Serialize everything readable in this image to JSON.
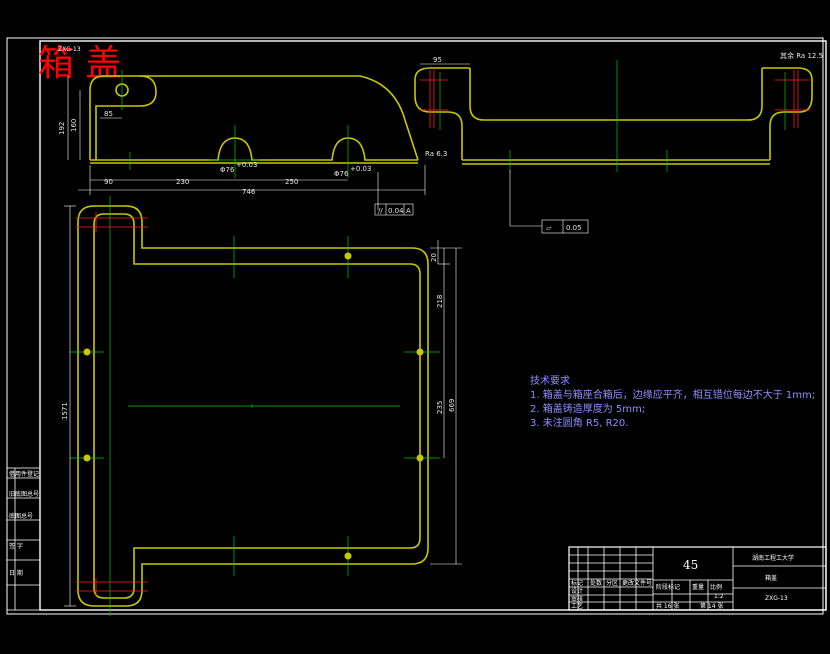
{
  "title_overlay": "箱 盖",
  "drawing_no_small": "ZXG-13",
  "colors": {
    "background": "#000000",
    "border": "#ffffff",
    "outline": "#c8c800",
    "center_line": "#00c800",
    "section_red": "#ff2020",
    "note_text": "#8f8fff",
    "title_red": "#ff0000"
  },
  "front_view": {
    "dims": {
      "h192": "192",
      "h160": "160",
      "r85": "85",
      "x90": "90",
      "x230": "230",
      "x250": "250",
      "total": "746",
      "bore1": "Φ76",
      "bore2": "Φ76",
      "bore1_tol": "+0.03",
      "bore2_tol": "+0.03",
      "ra_right": "Ra 6.3",
      "tol_frame_sym": "//",
      "tol_frame_val": "0.04",
      "tol_frame_ref": "A"
    }
  },
  "side_view": {
    "dims": {
      "w95": "95"
    },
    "flatness_sym": "▱",
    "flatness_val": "0.05",
    "corner_mark": "其余 Ra 12.5"
  },
  "top_view": {
    "dims": {
      "h1571": "1571",
      "h669": "669",
      "d218": "218",
      "d235": "235",
      "d20": "20"
    }
  },
  "notes": {
    "heading": "技术要求",
    "line1": "1. 箱盖与箱座合箱后，边缘应平齐，相互错位每边不大于 1mm;",
    "line2": "2. 箱盖铸造厚度为 5mm;",
    "line3": "3. 未注圆角 R5, R20."
  },
  "title_block": {
    "material": "45",
    "school": "湖南工程工大学",
    "part_name": "箱盖",
    "drawing_no": "ZXG-13",
    "scale": "1:2",
    "sheet_label": "共 16 张",
    "sheet_of": "第 14 张",
    "cells": [
      "标记",
      "处数",
      "分区",
      "更改文件号",
      "签名",
      "年月日",
      "设计",
      "标准化",
      "审核",
      "工艺",
      "批准",
      "阶段标记",
      "重量",
      "比例"
    ]
  },
  "left_strip": {
    "labels": [
      "借用件登记",
      "旧底图总号",
      "底图总号",
      "签 字",
      "日 期"
    ]
  }
}
